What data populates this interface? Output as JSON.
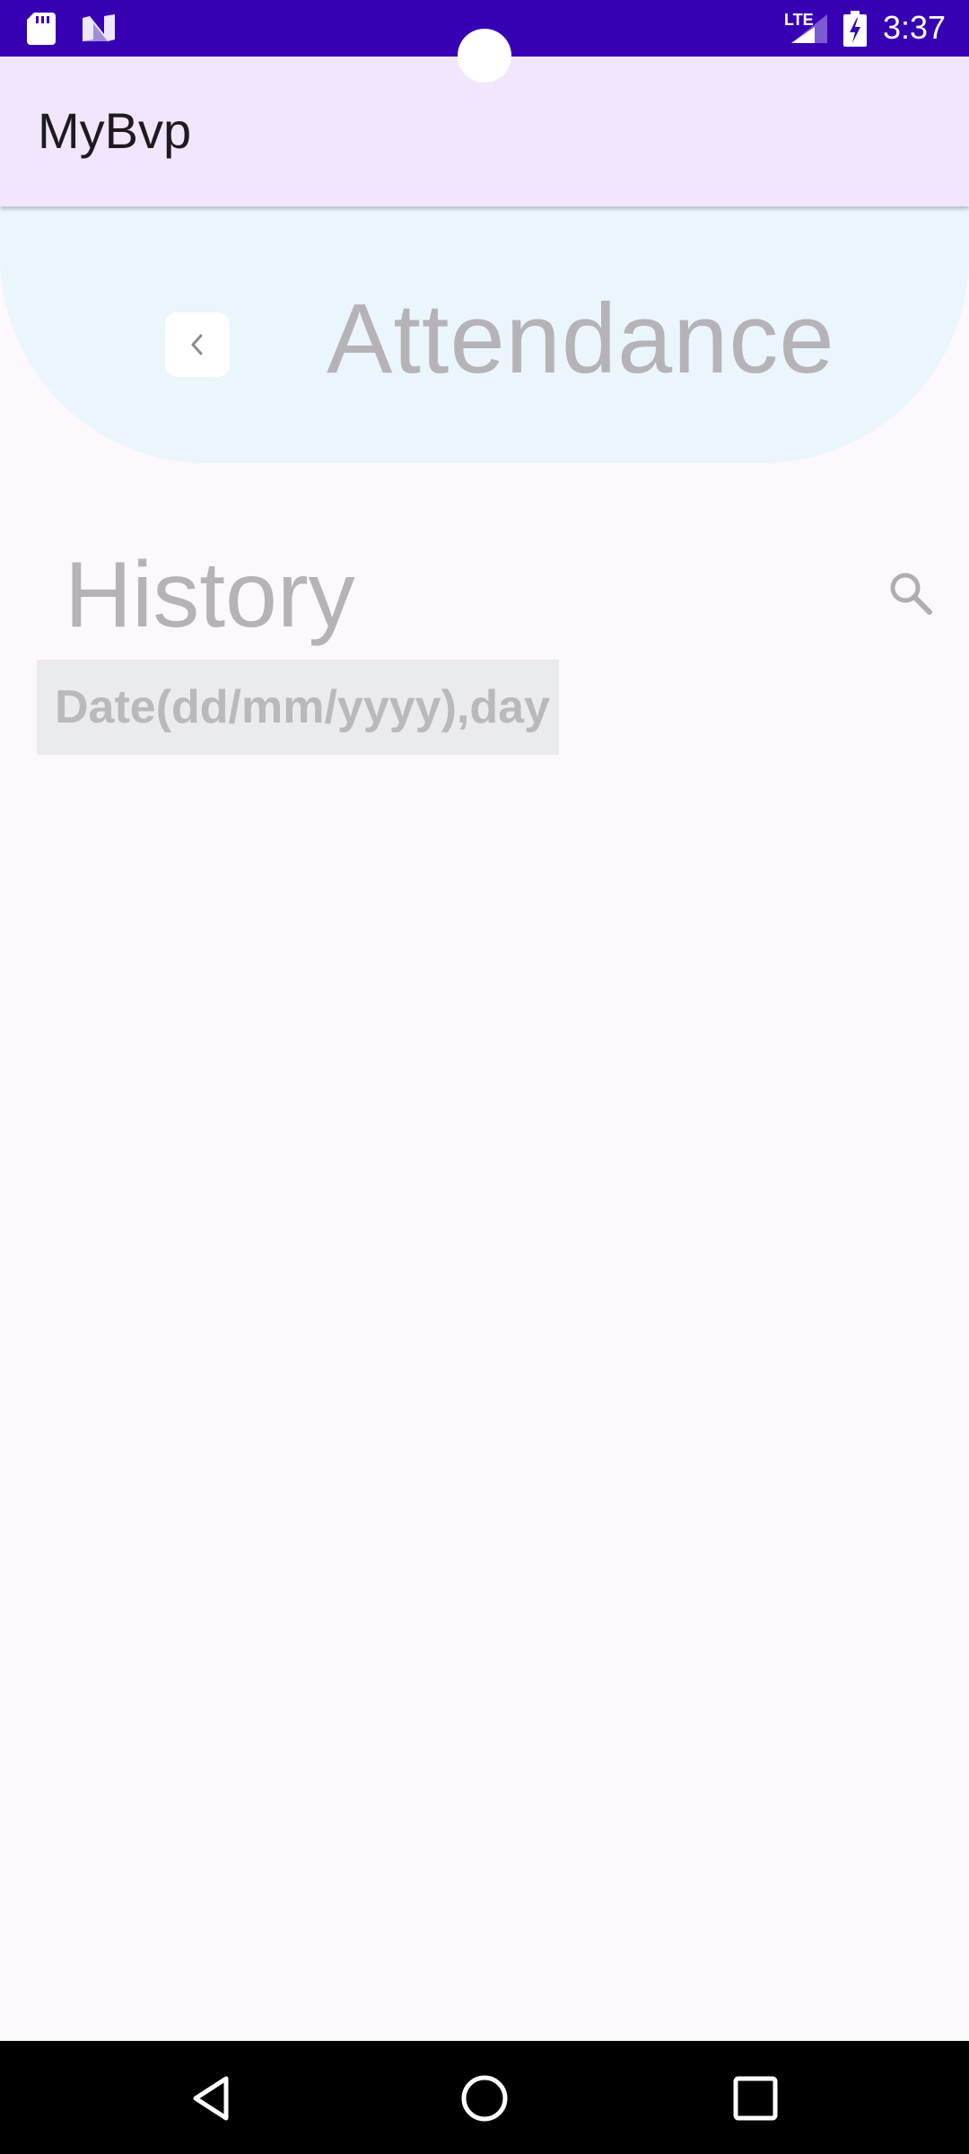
{
  "status_bar": {
    "time": "3:37",
    "network_label": "LTE",
    "icons": [
      "sd-card-icon",
      "n-notification-icon",
      "signal-icon",
      "battery-charging-icon"
    ]
  },
  "app_bar": {
    "title": "MyBvp"
  },
  "header": {
    "back_icon": "chevron-left-icon",
    "title": "Attendance"
  },
  "history": {
    "title": "History",
    "search_icon": "search-icon",
    "date_placeholder": "Date(dd/mm/yyyy),day"
  },
  "nav_bar": {
    "icons": [
      "back-triangle-icon",
      "home-circle-icon",
      "recents-square-icon"
    ]
  },
  "colors": {
    "status_bar": "#3700b3",
    "app_bar": "#f2e6fc",
    "header_banner": "#eaf6fc",
    "background": "#fdf8fd",
    "muted_text": "#b5b3b8"
  }
}
